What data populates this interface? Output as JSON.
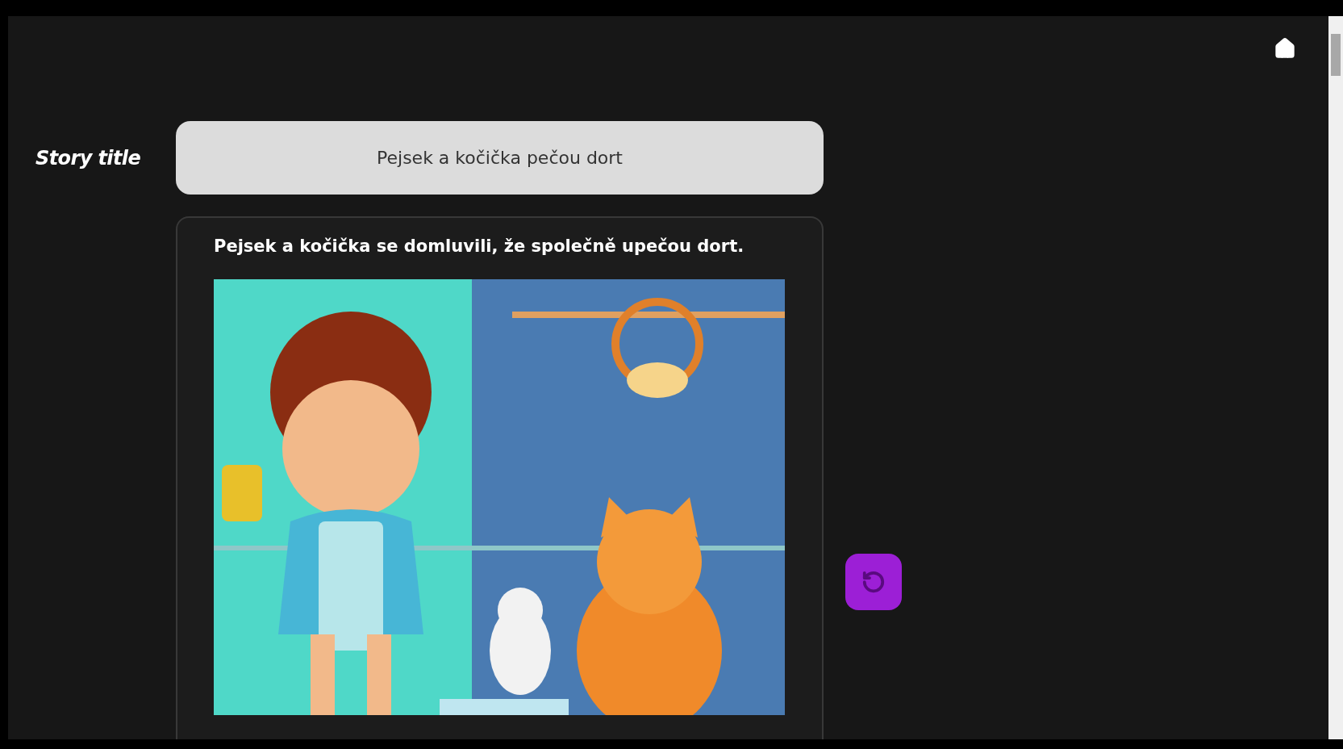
{
  "story_title": {
    "label": "Story title",
    "value": "Pejsek a kočička pečou dort"
  },
  "story": {
    "paragraph": "Pejsek a kočička se domluvili, že společně upečou dort."
  }
}
